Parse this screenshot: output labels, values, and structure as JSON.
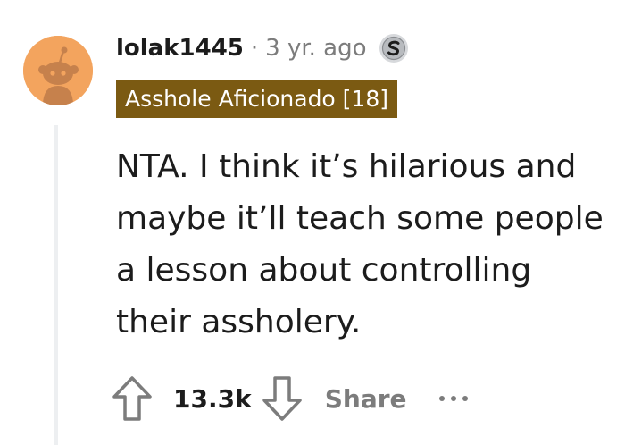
{
  "comment": {
    "author": "lolak1445",
    "separator": "·",
    "timestamp": "3 yr. ago",
    "author_flair": "Asshole Aficionado [18]",
    "body": "NTA. I think it’s hilarious and maybe it’ll teach some people a lesson about controlling their assholery.",
    "score": "13.3k",
    "award_icon": "silver-award-icon"
  },
  "actions": {
    "share_label": "Share",
    "more_icon": "more-options-icon",
    "upvote_icon": "upvote-arrow-icon",
    "downvote_icon": "downvote-arrow-icon"
  },
  "colors": {
    "avatar_background": "#f3a45e",
    "flair_background": "#7b5a12",
    "flair_text": "#ffffff",
    "muted_text": "#7c7c7c",
    "primary_text": "#1c1c1c",
    "thread_line": "#edeff1"
  }
}
